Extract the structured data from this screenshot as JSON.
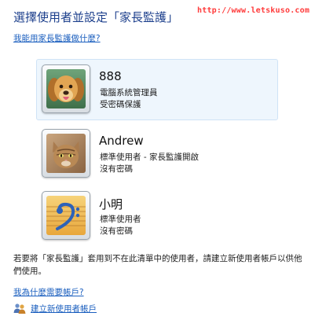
{
  "header": {
    "title": "選擇使用者並設定「家長監護」",
    "watermark": "http://www.letskuso.com",
    "help_link": "我能用家長監護做什麼?"
  },
  "users": [
    {
      "name": "888",
      "role": "電腦系統管理員",
      "password_status": "受密碼保護",
      "avatar": "golden-retriever-dog",
      "selected": true
    },
    {
      "name": "Andrew",
      "role": "標準使用者 - 家長監護開啟",
      "password_status": "沒有密碼",
      "avatar": "kitten",
      "selected": false
    },
    {
      "name": "小明",
      "role": "標準使用者",
      "password_status": "沒有密碼",
      "avatar": "bass-clef-music-sheet",
      "selected": false
    }
  ],
  "footer": {
    "note": "若要將「家長監護」套用到不在此清單中的使用者，請建立新使用者帳戶以供他們使用。",
    "why_link": "我為什麼需要帳戶?",
    "create_link": "建立新使用者帳戶",
    "create_icon": "users-icon"
  },
  "colors": {
    "title": "#1c3f8c",
    "link": "#1b5fbf",
    "watermark": "#ff3b3b",
    "selected_bg": "#eef6fd"
  }
}
